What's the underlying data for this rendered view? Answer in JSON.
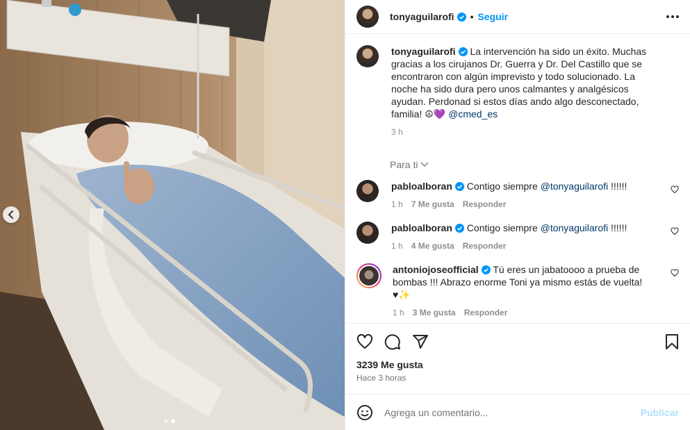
{
  "post": {
    "author": "tonyaguilarofi",
    "separator": "•",
    "follow_label": "Seguir",
    "caption_user": "tonyaguilarofi",
    "caption_text": "La intervención ha sido un éxito. Muchas gracias a los cirujanos Dr. Guerra y Dr. Del Castillo que se encontraron con algún imprevisto y todo solucionado. La noche ha sido dura pero unos calmantes y analgésicos ayudan. Perdonad si estos días ando algo desconectado, familia!",
    "caption_emoji": "☮💜",
    "caption_mention": "@cmed_es",
    "caption_time": "3 h",
    "filter_label": "Para ti",
    "likes": "3239 Me gusta",
    "posted": "Hace 3 horas",
    "carousel": {
      "total": 2,
      "active": 2
    }
  },
  "comments": [
    {
      "user": "pabloalboran",
      "text": "Contigo siempre",
      "mention": "@tonyaguilarofi",
      "tail": "!!!!!!",
      "time": "1 h",
      "likes": "7 Me gusta",
      "reply": "Responder"
    },
    {
      "user": "pabloalboran",
      "text": "Contigo siempre",
      "mention": "@tonyaguilarofi",
      "tail": "!!!!!!",
      "time": "1 h",
      "likes": "4 Me gusta",
      "reply": "Responder"
    },
    {
      "user": "antoniojoseofficial",
      "text": "Tú eres un jabatoooo a prueba de bombas !!! Abrazo enorme Toni ya mismo estás de vuelta! ♥✨",
      "time": "1 h",
      "likes": "3 Me gusta",
      "reply": "Responder"
    }
  ],
  "composer": {
    "placeholder": "Agrega un comentario...",
    "publish_label": "Publicar"
  },
  "colors": {
    "accent": "#0095f6",
    "verified": "#0095f6",
    "publish_disabled": "#b2dffc",
    "muted": "#737373"
  },
  "icons": [
    "chevron-left-icon",
    "ellipsis-icon",
    "verified-badge-icon",
    "heart-icon",
    "comment-icon",
    "share-icon",
    "bookmark-icon",
    "emoji-icon",
    "chevron-down-icon"
  ]
}
